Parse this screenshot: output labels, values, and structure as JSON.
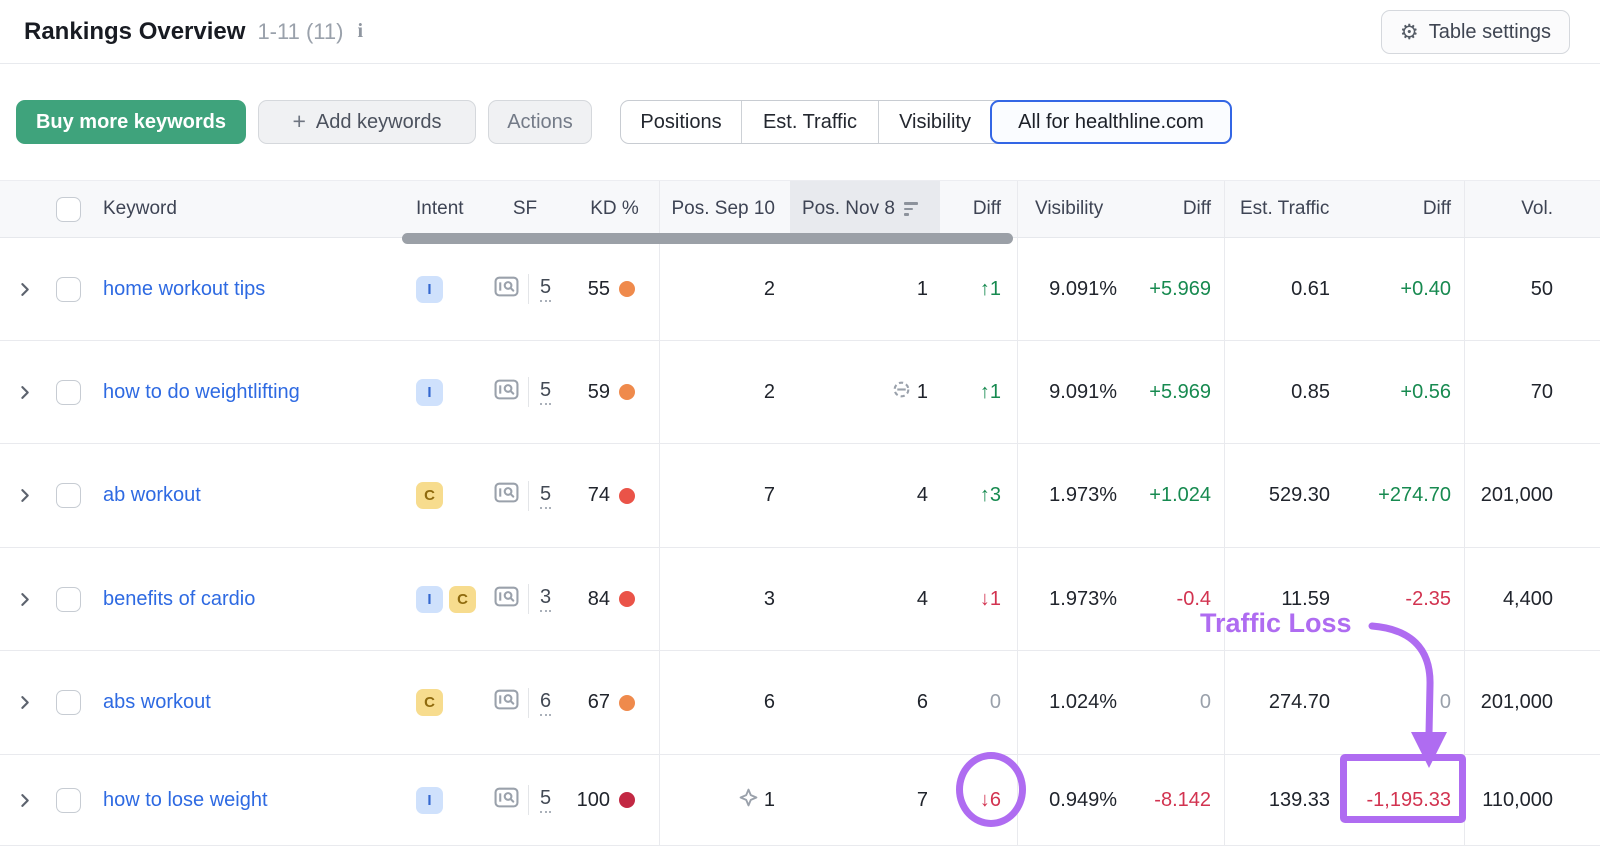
{
  "header": {
    "title": "Rankings Overview",
    "range": "1-11 (11)",
    "info_icon": "i",
    "table_settings_label": "Table settings",
    "table_settings_icon": "gear-icon"
  },
  "toolbar": {
    "buy_label": "Buy more keywords",
    "plus_icon": "+",
    "add_label": "Add keywords",
    "actions_label": "Actions",
    "segments": [
      {
        "label": "Positions",
        "active": false
      },
      {
        "label": "Est. Traffic",
        "active": false
      },
      {
        "label": "Visibility",
        "active": false
      },
      {
        "label": "All for healthline.com",
        "active": true
      }
    ]
  },
  "table": {
    "headers": {
      "keyword": "Keyword",
      "intent": "Intent",
      "sf": "SF",
      "kd": "KD %",
      "pos_prev": "Pos. Sep 10",
      "pos_new": "Pos. Nov 8",
      "diff1": "Diff",
      "visibility": "Visibility",
      "diff2": "Diff",
      "traffic": "Est. Traffic",
      "diff3": "Diff",
      "vol": "Vol."
    },
    "sorted_column": "Pos. Nov 8",
    "rows": [
      {
        "keyword": "home workout tips",
        "intents": [
          "I"
        ],
        "sf": "5",
        "kd": "55",
        "kd_level": "orange",
        "pos_prev": "2",
        "pos_new": "1",
        "pos_diff": "↑1",
        "visibility": "9.091%",
        "vis_diff": "+5.969",
        "traffic": "0.61",
        "traffic_diff": "+0.40",
        "vol": "50"
      },
      {
        "keyword": "how to do weightlifting",
        "intents": [
          "I"
        ],
        "sf": "5",
        "kd": "59",
        "kd_level": "orange",
        "pos_prev": "2",
        "pos_new": "1",
        "pos_new_icon": "link-icon",
        "pos_diff": "↑1",
        "visibility": "9.091%",
        "vis_diff": "+5.969",
        "traffic": "0.85",
        "traffic_diff": "+0.56",
        "vol": "70"
      },
      {
        "keyword": "ab workout",
        "intents": [
          "C"
        ],
        "sf": "5",
        "kd": "74",
        "kd_level": "red",
        "pos_prev": "7",
        "pos_new": "4",
        "pos_diff": "↑3",
        "visibility": "1.973%",
        "vis_diff": "+1.024",
        "traffic": "529.30",
        "traffic_diff": "+274.70",
        "vol": "201,000"
      },
      {
        "keyword": "benefits of cardio",
        "intents": [
          "I",
          "C"
        ],
        "sf": "3",
        "kd": "84",
        "kd_level": "red",
        "pos_prev": "3",
        "pos_new": "4",
        "pos_diff": "↓1",
        "visibility": "1.973%",
        "vis_diff": "-0.4",
        "traffic": "11.59",
        "traffic_diff": "-2.35",
        "vol": "4,400"
      },
      {
        "keyword": "abs workout",
        "intents": [
          "C"
        ],
        "sf": "6",
        "kd": "67",
        "kd_level": "orange",
        "pos_prev": "6",
        "pos_new": "6",
        "pos_diff": "0",
        "visibility": "1.024%",
        "vis_diff": "0",
        "traffic": "274.70",
        "traffic_diff": "0",
        "vol": "201,000"
      },
      {
        "keyword": "how to lose weight",
        "intents": [
          "I"
        ],
        "sf": "5",
        "kd": "100",
        "kd_level": "darkred",
        "pos_prev": "1",
        "pos_prev_icon": "featured-snippet-icon",
        "pos_new": "7",
        "pos_diff": "↓6",
        "visibility": "0.949%",
        "vis_diff": "-8.142",
        "traffic": "139.33",
        "traffic_diff": "-1,195.33",
        "vol": "110,000"
      }
    ]
  },
  "annotation": {
    "label": "Traffic Loss",
    "circled_value": "↓6",
    "boxed_value": "-1,195.33",
    "color": "#af6cf1"
  },
  "colors": {
    "positive": "#178a50",
    "negative": "#d23350",
    "neutral": "#9aa1ab",
    "link": "#2e6ae2",
    "buy_button": "#3fa37c",
    "active_tab_border": "#3366e5",
    "kd_orange": "#ef8a4c",
    "kd_red": "#ea5348",
    "kd_darkred": "#c22843",
    "annotation_purple": "#af6cf1"
  }
}
